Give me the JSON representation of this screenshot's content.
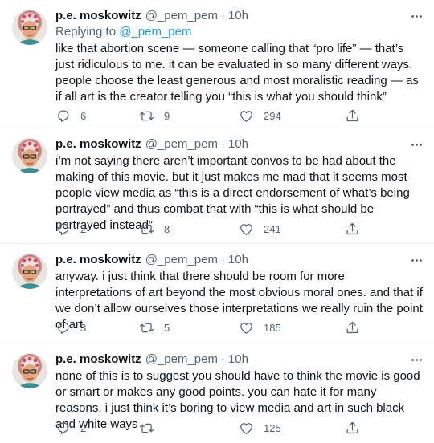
{
  "tweets": [
    {
      "name": "p.e. moskowitz",
      "handle": "@_pem_pem",
      "time": "10h",
      "reply_prefix": "Replying to ",
      "reply_to": "@_pem_pem",
      "text": "like that abortion scene — someone calling that “pro life” — that’s just ridiculous to me. it can be evaluated in so many different ways. people choose the least generous and most moralistic reading — as if all art is the creator telling you “this is what you should think”",
      "replies": "6",
      "retweets": "9",
      "likes": "294"
    },
    {
      "name": "p.e. moskowitz",
      "handle": "@_pem_pem",
      "time": "10h",
      "text": "i’m not saying there aren’t important convos to be had about the making of this movie. but it just makes me mad that it seems most people view media as “this is a direct endorsement of what’s being portrayed” and thus combat that with “this is what should be portrayed instead”",
      "replies": "2",
      "retweets": "8",
      "likes": "241"
    },
    {
      "name": "p.e. moskowitz",
      "handle": "@_pem_pem",
      "time": "10h",
      "text": "anyway. i just think that there should be room for more interpretations of art beyond the most obvious moral ones. and that if we don’t allow ourselves those interpretations we really ruin the point of art",
      "replies": "3",
      "retweets": "5",
      "likes": "185"
    },
    {
      "name": "p.e. moskowitz",
      "handle": "@_pem_pem",
      "time": "10h",
      "text": "none of this is to suggest you should have to think the movie is good or smart or makes any good points. you can hate it for many reasons. i just think it’s boring to view media and art in such black and white ways",
      "replies": "2",
      "retweets": "",
      "likes": "125"
    }
  ],
  "dot": "·",
  "icons": {
    "more": "more-horizontal-icon",
    "reply": "reply-icon",
    "retweet": "retweet-icon",
    "like": "heart-icon",
    "share": "share-icon"
  },
  "colors": {
    "text": "#0f1419",
    "secondary": "#536471",
    "link": "#1d9bf0",
    "divider": "#eff3f4"
  }
}
